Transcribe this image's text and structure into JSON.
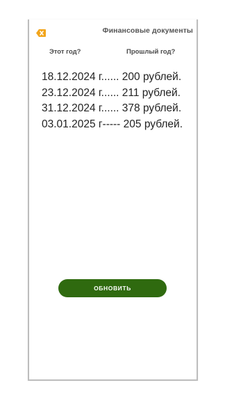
{
  "header": {
    "title": "Финансовые документы",
    "back_icon": "close-x-icon",
    "accent_color": "#f2a51c"
  },
  "tabs": [
    {
      "label": "Этот год?"
    },
    {
      "label": "Прошлый год?"
    }
  ],
  "records": [
    "18.12.2024 г...... 200 рублей.",
    "23.12.2024 г...... 211 рублей.",
    "31.12.2024 г...... 378 рублей.",
    "03.01.2025 г----- 205 рублей."
  ],
  "actions": {
    "update_label": "ОБНОВИТЬ",
    "update_color": "#2f6a0f"
  }
}
